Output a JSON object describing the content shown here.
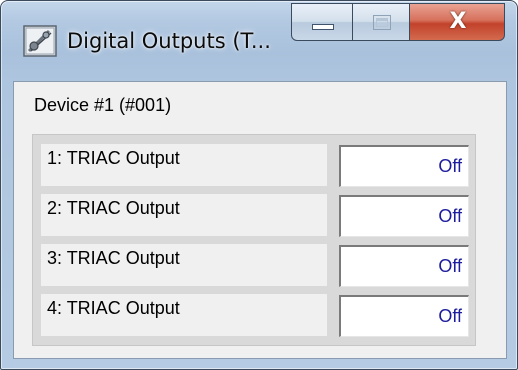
{
  "window": {
    "title": "Digital Outputs (T...",
    "app_icon": "app-gear-icon",
    "caption_buttons": {
      "minimize_icon": "minimize-icon",
      "maximize_icon": "maximize-icon",
      "close_glyph": "X"
    }
  },
  "device": {
    "label": "Device #1 (#001)"
  },
  "outputs": [
    {
      "label": "1: TRIAC Output",
      "value": "Off"
    },
    {
      "label": "2: TRIAC Output",
      "value": "Off"
    },
    {
      "label": "3: TRIAC Output",
      "value": "Off"
    },
    {
      "label": "4: TRIAC Output",
      "value": "Off"
    }
  ],
  "colors": {
    "value_text": "#1c1c9c",
    "close_button": "#c2422a",
    "frame": "#b3c9e2"
  }
}
